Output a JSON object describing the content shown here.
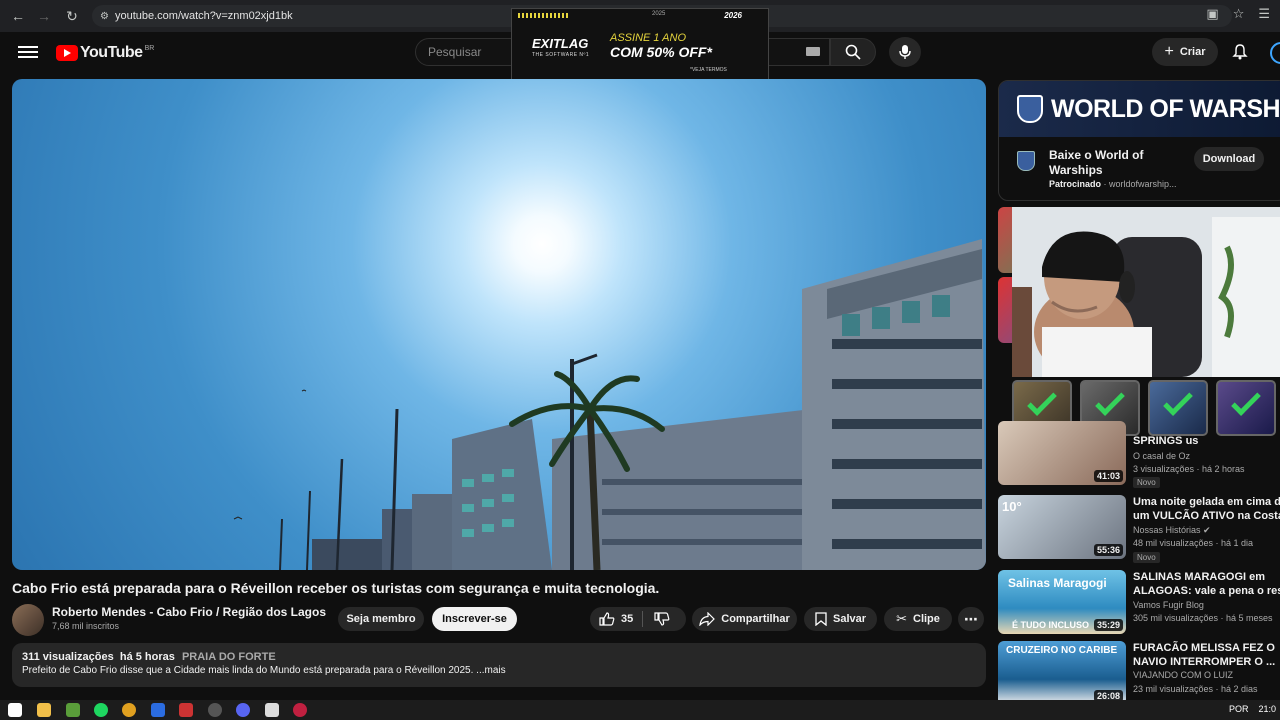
{
  "browser": {
    "url": "youtube.com/watch?v=znm02xjd1bk"
  },
  "masthead": {
    "logo_text": "YouTube",
    "country_code": "BR",
    "search_placeholder": "Pesquisar",
    "create_label": "Criar"
  },
  "overlay_ad": {
    "brand": "EXITLAG",
    "tagline": "THE SOFTWARE Nº1",
    "line1": "ASSINE 1 ANO",
    "line2": "COM 50% OFF*",
    "terms": "*VEJA TERMOS",
    "year": "2025",
    "year2": "2026"
  },
  "video": {
    "title": "Cabo Frio está preparada para o Réveillon receber os turistas com segurança e muita tecnologia.",
    "channel": "Roberto Mendes - Cabo Frio / Região dos Lagos",
    "subscribers": "7,68 mil inscritos",
    "join_label": "Seja membro",
    "subscribe_label": "Inscrever-se",
    "likes": "35",
    "share_label": "Compartilhar",
    "save_label": "Salvar",
    "clip_label": "Clipe",
    "views": "311 visualizações",
    "age": "há 5 horas",
    "location": "PRAIA DO FORTE",
    "description": "Prefeito de Cabo Frio disse que a Cidade mais linda do Mundo está preparada para o Réveillon 2025. ...mais"
  },
  "sidebar_ad": {
    "banner_title": "WORLD OF WARSHIPS",
    "title": "Baixe o World of Warships",
    "sponsored": "Patrocinado",
    "domain": "worldofwarship...",
    "download_label": "Download"
  },
  "recommendations": [
    {
      "title": "SPRINGS us",
      "channel": "O casal de Oz",
      "stats": "3 visualizações · há 2 horas",
      "badge": "Novo",
      "duration": "41:03"
    },
    {
      "title_line1": "Uma noite gelada em cima de",
      "title_line2": "um VULCÃO ATIVO na Costa ...",
      "channel": "Nossas Histórias",
      "stats": "48 mil visualizações · há 1 dia",
      "badge": "Novo",
      "duration": "55:36",
      "thumb_text": "10°"
    },
    {
      "title_line1": "SALINAS MARAGOGI em",
      "title_line2": "ALAGOAS: vale a pena o resort",
      "channel": "Vamos Fugir Blog",
      "stats": "305 mil visualizações · há 5 meses",
      "duration": "35:29",
      "thumb_text": "Salinas Maragogi",
      "thumb_text2": "É TUDO INCLUSO"
    },
    {
      "title_line1": "FURACÃO MELISSA FEZ O",
      "title_line2": "NAVIO INTERROMPER O ...",
      "channel": "VIAJANDO COM O LUIZ",
      "stats": "23 mil visualizações · há 2 dias",
      "duration": "26:08",
      "thumb_text": "CRUZEIRO NO CARIBE"
    }
  ],
  "taskbar": {
    "language": "POR",
    "time": "21:0"
  }
}
